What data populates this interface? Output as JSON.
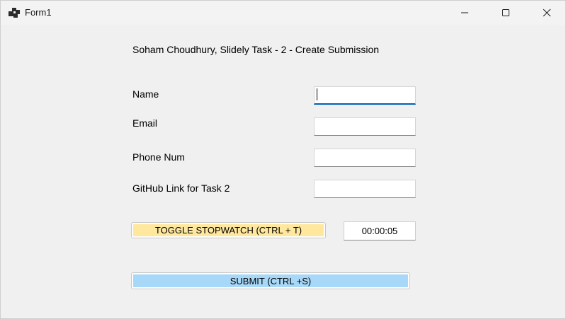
{
  "window": {
    "title": "Form1",
    "icon": "windows-forms-app-icon",
    "controls": {
      "minimize": "minimize-icon",
      "maximize": "maximize-icon",
      "close": "close-icon"
    }
  },
  "form": {
    "heading": "Soham Choudhury, Slidely Task - 2 - Create Submission",
    "fields": {
      "name_label": "Name",
      "name_value": "",
      "email_label": "Email",
      "email_value": "",
      "phone_label": "Phone Num",
      "phone_value": "",
      "github_label": "GitHub Link for Task 2",
      "github_value": ""
    },
    "stopwatch": {
      "button_label": "TOGGLE STOPWATCH (CTRL + T)",
      "button_color": "#ffe89e",
      "elapsed": "00:00:05"
    },
    "submit": {
      "button_label": "SUBMIT (CTRL +S)",
      "button_color": "#a8d8f8"
    }
  }
}
